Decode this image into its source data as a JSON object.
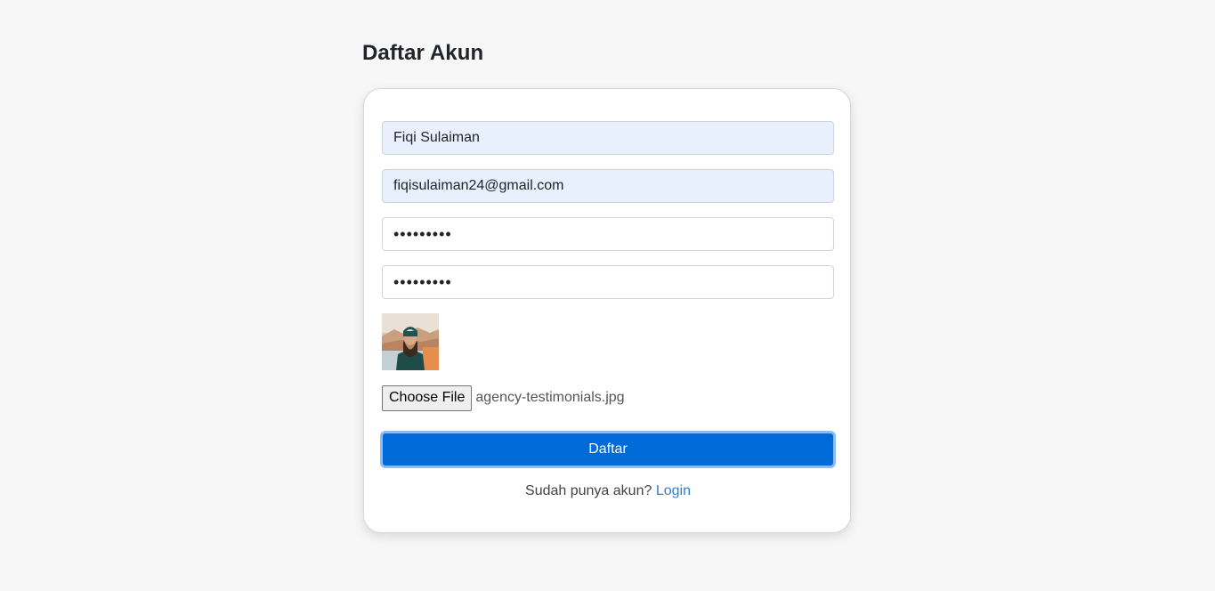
{
  "page": {
    "title": "Daftar Akun"
  },
  "form": {
    "name_value": "Fiqi Sulaiman",
    "email_value": "fiqisulaiman24@gmail.com",
    "password_value": "•••••••••",
    "password_confirm_value": "•••••••••",
    "file_button_label": "Choose File",
    "file_name": "agency-testimonials.jpg",
    "submit_label": "Daftar",
    "footer_prompt": "Sudah punya akun?",
    "login_link": "Login"
  },
  "colors": {
    "background": "#f7f7f7",
    "autofill": "#e8f0fe",
    "primary": "#006ad9",
    "link": "#2f7fd8"
  }
}
